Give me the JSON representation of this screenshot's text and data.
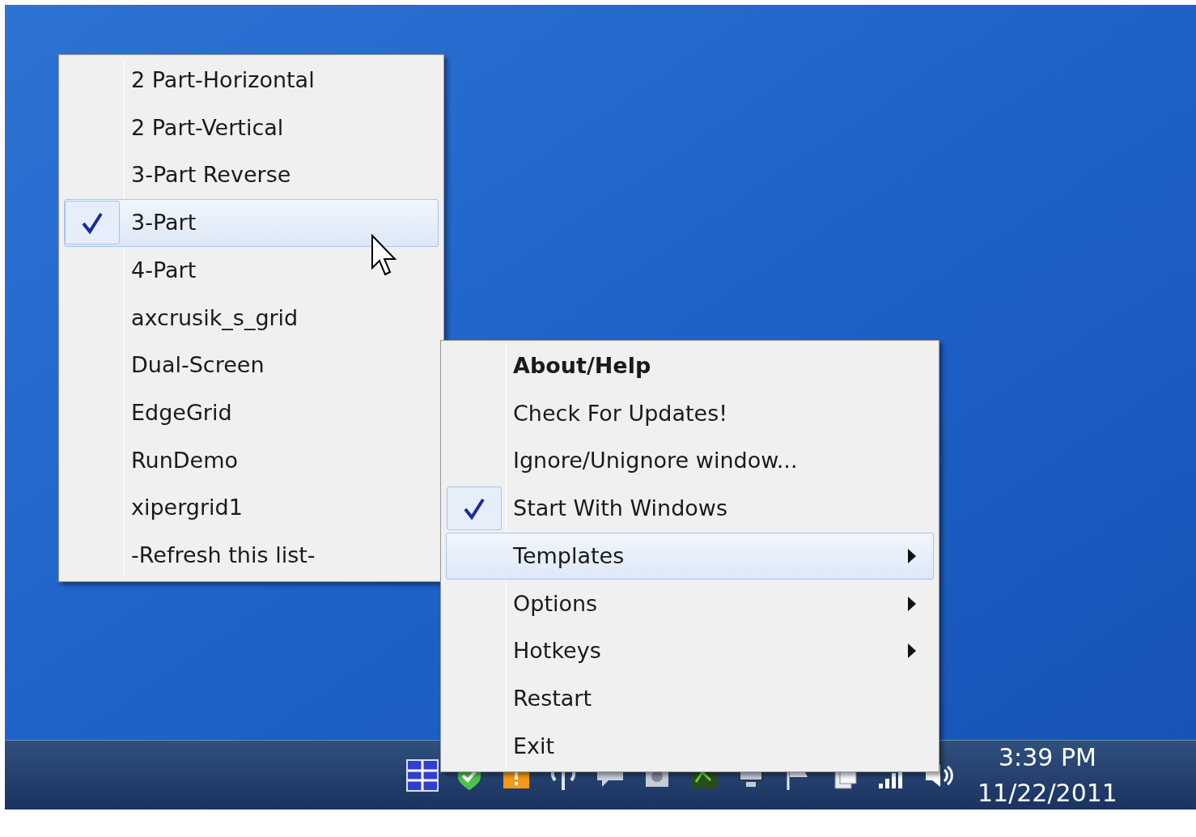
{
  "templates_menu": {
    "items": [
      {
        "label": "2 Part-Horizontal",
        "checked": false,
        "selected": false
      },
      {
        "label": "2 Part-Vertical",
        "checked": false,
        "selected": false
      },
      {
        "label": "3-Part Reverse",
        "checked": false,
        "selected": false
      },
      {
        "label": "3-Part",
        "checked": true,
        "selected": true
      },
      {
        "label": "4-Part",
        "checked": false,
        "selected": false
      },
      {
        "label": "axcrusik_s_grid",
        "checked": false,
        "selected": false
      },
      {
        "label": "Dual-Screen",
        "checked": false,
        "selected": false
      },
      {
        "label": "EdgeGrid",
        "checked": false,
        "selected": false
      },
      {
        "label": "RunDemo",
        "checked": false,
        "selected": false
      },
      {
        "label": "xipergrid1",
        "checked": false,
        "selected": false
      },
      {
        "label": "-Refresh this list-",
        "checked": false,
        "selected": false
      }
    ]
  },
  "tray_menu": {
    "items": [
      {
        "label": "About/Help",
        "bold": true,
        "checked": false,
        "selected": false,
        "submenu": false
      },
      {
        "label": "Check For Updates!",
        "bold": false,
        "checked": false,
        "selected": false,
        "submenu": false
      },
      {
        "label": "Ignore/Unignore window...",
        "bold": false,
        "checked": false,
        "selected": false,
        "submenu": false
      },
      {
        "label": "Start With Windows",
        "bold": false,
        "checked": true,
        "selected": false,
        "submenu": false
      },
      {
        "label": "Templates",
        "bold": false,
        "checked": false,
        "selected": true,
        "submenu": true
      },
      {
        "label": "Options",
        "bold": false,
        "checked": false,
        "selected": false,
        "submenu": true
      },
      {
        "label": "Hotkeys",
        "bold": false,
        "checked": false,
        "selected": false,
        "submenu": true
      },
      {
        "label": "Restart",
        "bold": false,
        "checked": false,
        "selected": false,
        "submenu": false
      },
      {
        "label": "Exit",
        "bold": false,
        "checked": false,
        "selected": false,
        "submenu": false
      }
    ]
  },
  "taskbar": {
    "clock": {
      "time": "3:39 PM",
      "date": "11/22/2011"
    }
  }
}
